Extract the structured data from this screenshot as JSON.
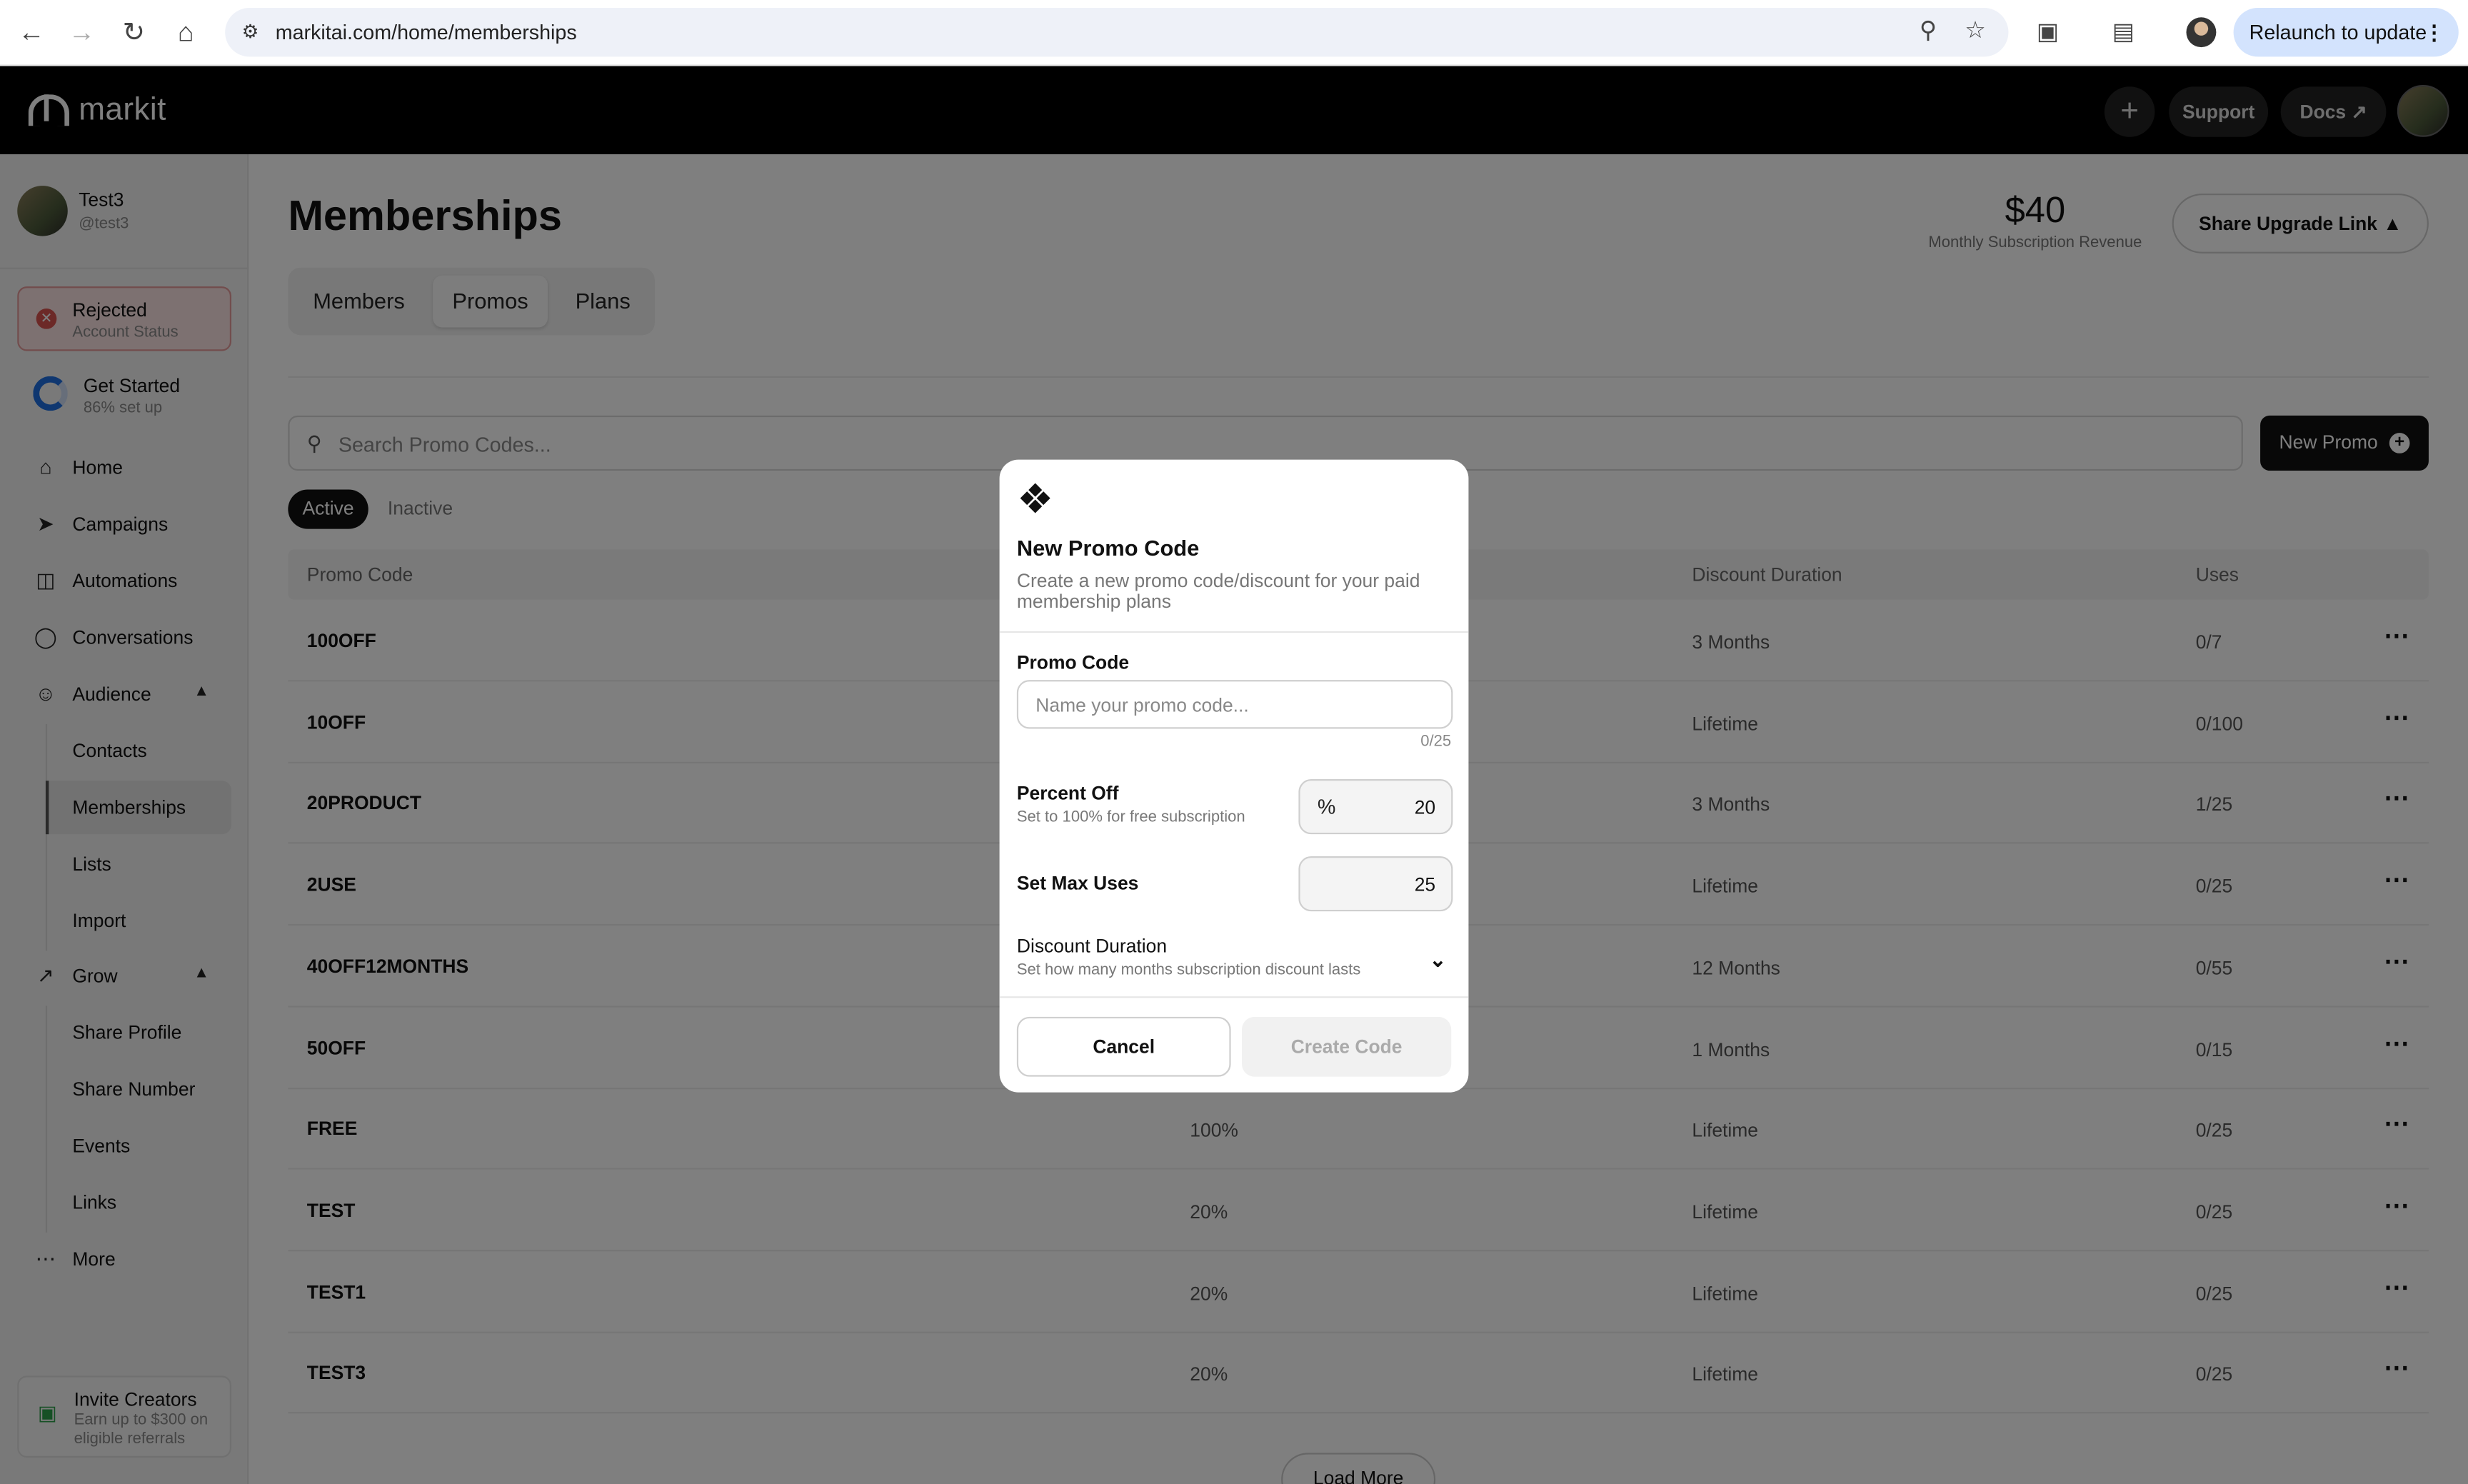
{
  "browser": {
    "url": "markitai.com/home/memberships",
    "relaunch_label": "Relaunch to update"
  },
  "topbar": {
    "logo_text": "markit",
    "support_label": "Support",
    "docs_label": "Docs"
  },
  "sidebar": {
    "user": {
      "name": "Test3",
      "handle": "@test3"
    },
    "status": {
      "title": "Rejected",
      "subtitle": "Account Status"
    },
    "get_started": {
      "title": "Get Started",
      "subtitle": "86% set up",
      "progress": 0.86
    },
    "nav": {
      "home": "Home",
      "campaigns": "Campaigns",
      "automations": "Automations",
      "conversations": "Conversations",
      "audience": "Audience",
      "contacts": "Contacts",
      "memberships": "Memberships",
      "lists": "Lists",
      "import": "Import",
      "grow": "Grow",
      "share_profile": "Share Profile",
      "share_number": "Share Number",
      "events": "Events",
      "links": "Links",
      "more": "More"
    },
    "invite": {
      "title": "Invite Creators",
      "subtitle": "Earn up to $300 on eligible referrals"
    }
  },
  "main": {
    "title": "Memberships",
    "revenue": {
      "amount": "$40",
      "caption": "Monthly Subscription Revenue"
    },
    "share_button": "Share Upgrade Link",
    "tabs": [
      "Members",
      "Promos",
      "Plans"
    ],
    "selected_tab": "Promos",
    "search_placeholder": "Search Promo Codes...",
    "new_promo_label": "New Promo",
    "filters": {
      "active": "Active",
      "inactive": "Inactive"
    },
    "table": {
      "headers": {
        "code": "Promo Code",
        "duration": "Discount Duration",
        "uses": "Uses"
      },
      "rows": [
        {
          "code": "100OFF",
          "off": "",
          "duration": "3 Months",
          "uses": "0/7"
        },
        {
          "code": "10OFF",
          "off": "",
          "duration": "Lifetime",
          "uses": "0/100"
        },
        {
          "code": "20PRODUCT",
          "off": "",
          "duration": "3 Months",
          "uses": "1/25"
        },
        {
          "code": "2USE",
          "off": "",
          "duration": "Lifetime",
          "uses": "0/25"
        },
        {
          "code": "40OFF12MONTHS",
          "off": "",
          "duration": "12 Months",
          "uses": "0/55"
        },
        {
          "code": "50OFF",
          "off": "",
          "duration": "1 Months",
          "uses": "0/15"
        },
        {
          "code": "FREE",
          "off": "100%",
          "duration": "Lifetime",
          "uses": "0/25"
        },
        {
          "code": "TEST",
          "off": "20%",
          "duration": "Lifetime",
          "uses": "0/25"
        },
        {
          "code": "TEST1",
          "off": "20%",
          "duration": "Lifetime",
          "uses": "0/25"
        },
        {
          "code": "TEST3",
          "off": "20%",
          "duration": "Lifetime",
          "uses": "0/25"
        }
      ]
    },
    "load_more": "Load More"
  },
  "modal": {
    "title": "New Promo Code",
    "description": "Create a new promo code/discount for your paid membership plans",
    "promo_code_label": "Promo Code",
    "promo_code_placeholder": "Name your promo code...",
    "promo_code_value": "",
    "char_count": "0/25",
    "percent_off": {
      "label": "Percent Off",
      "hint": "Set to 100% for free subscription",
      "prefix": "%",
      "value": "20"
    },
    "max_uses": {
      "label": "Set Max Uses",
      "value": "25"
    },
    "duration": {
      "label": "Discount Duration",
      "hint": "Set how many months subscription discount lasts"
    },
    "cancel_label": "Cancel",
    "create_label": "Create Code"
  }
}
